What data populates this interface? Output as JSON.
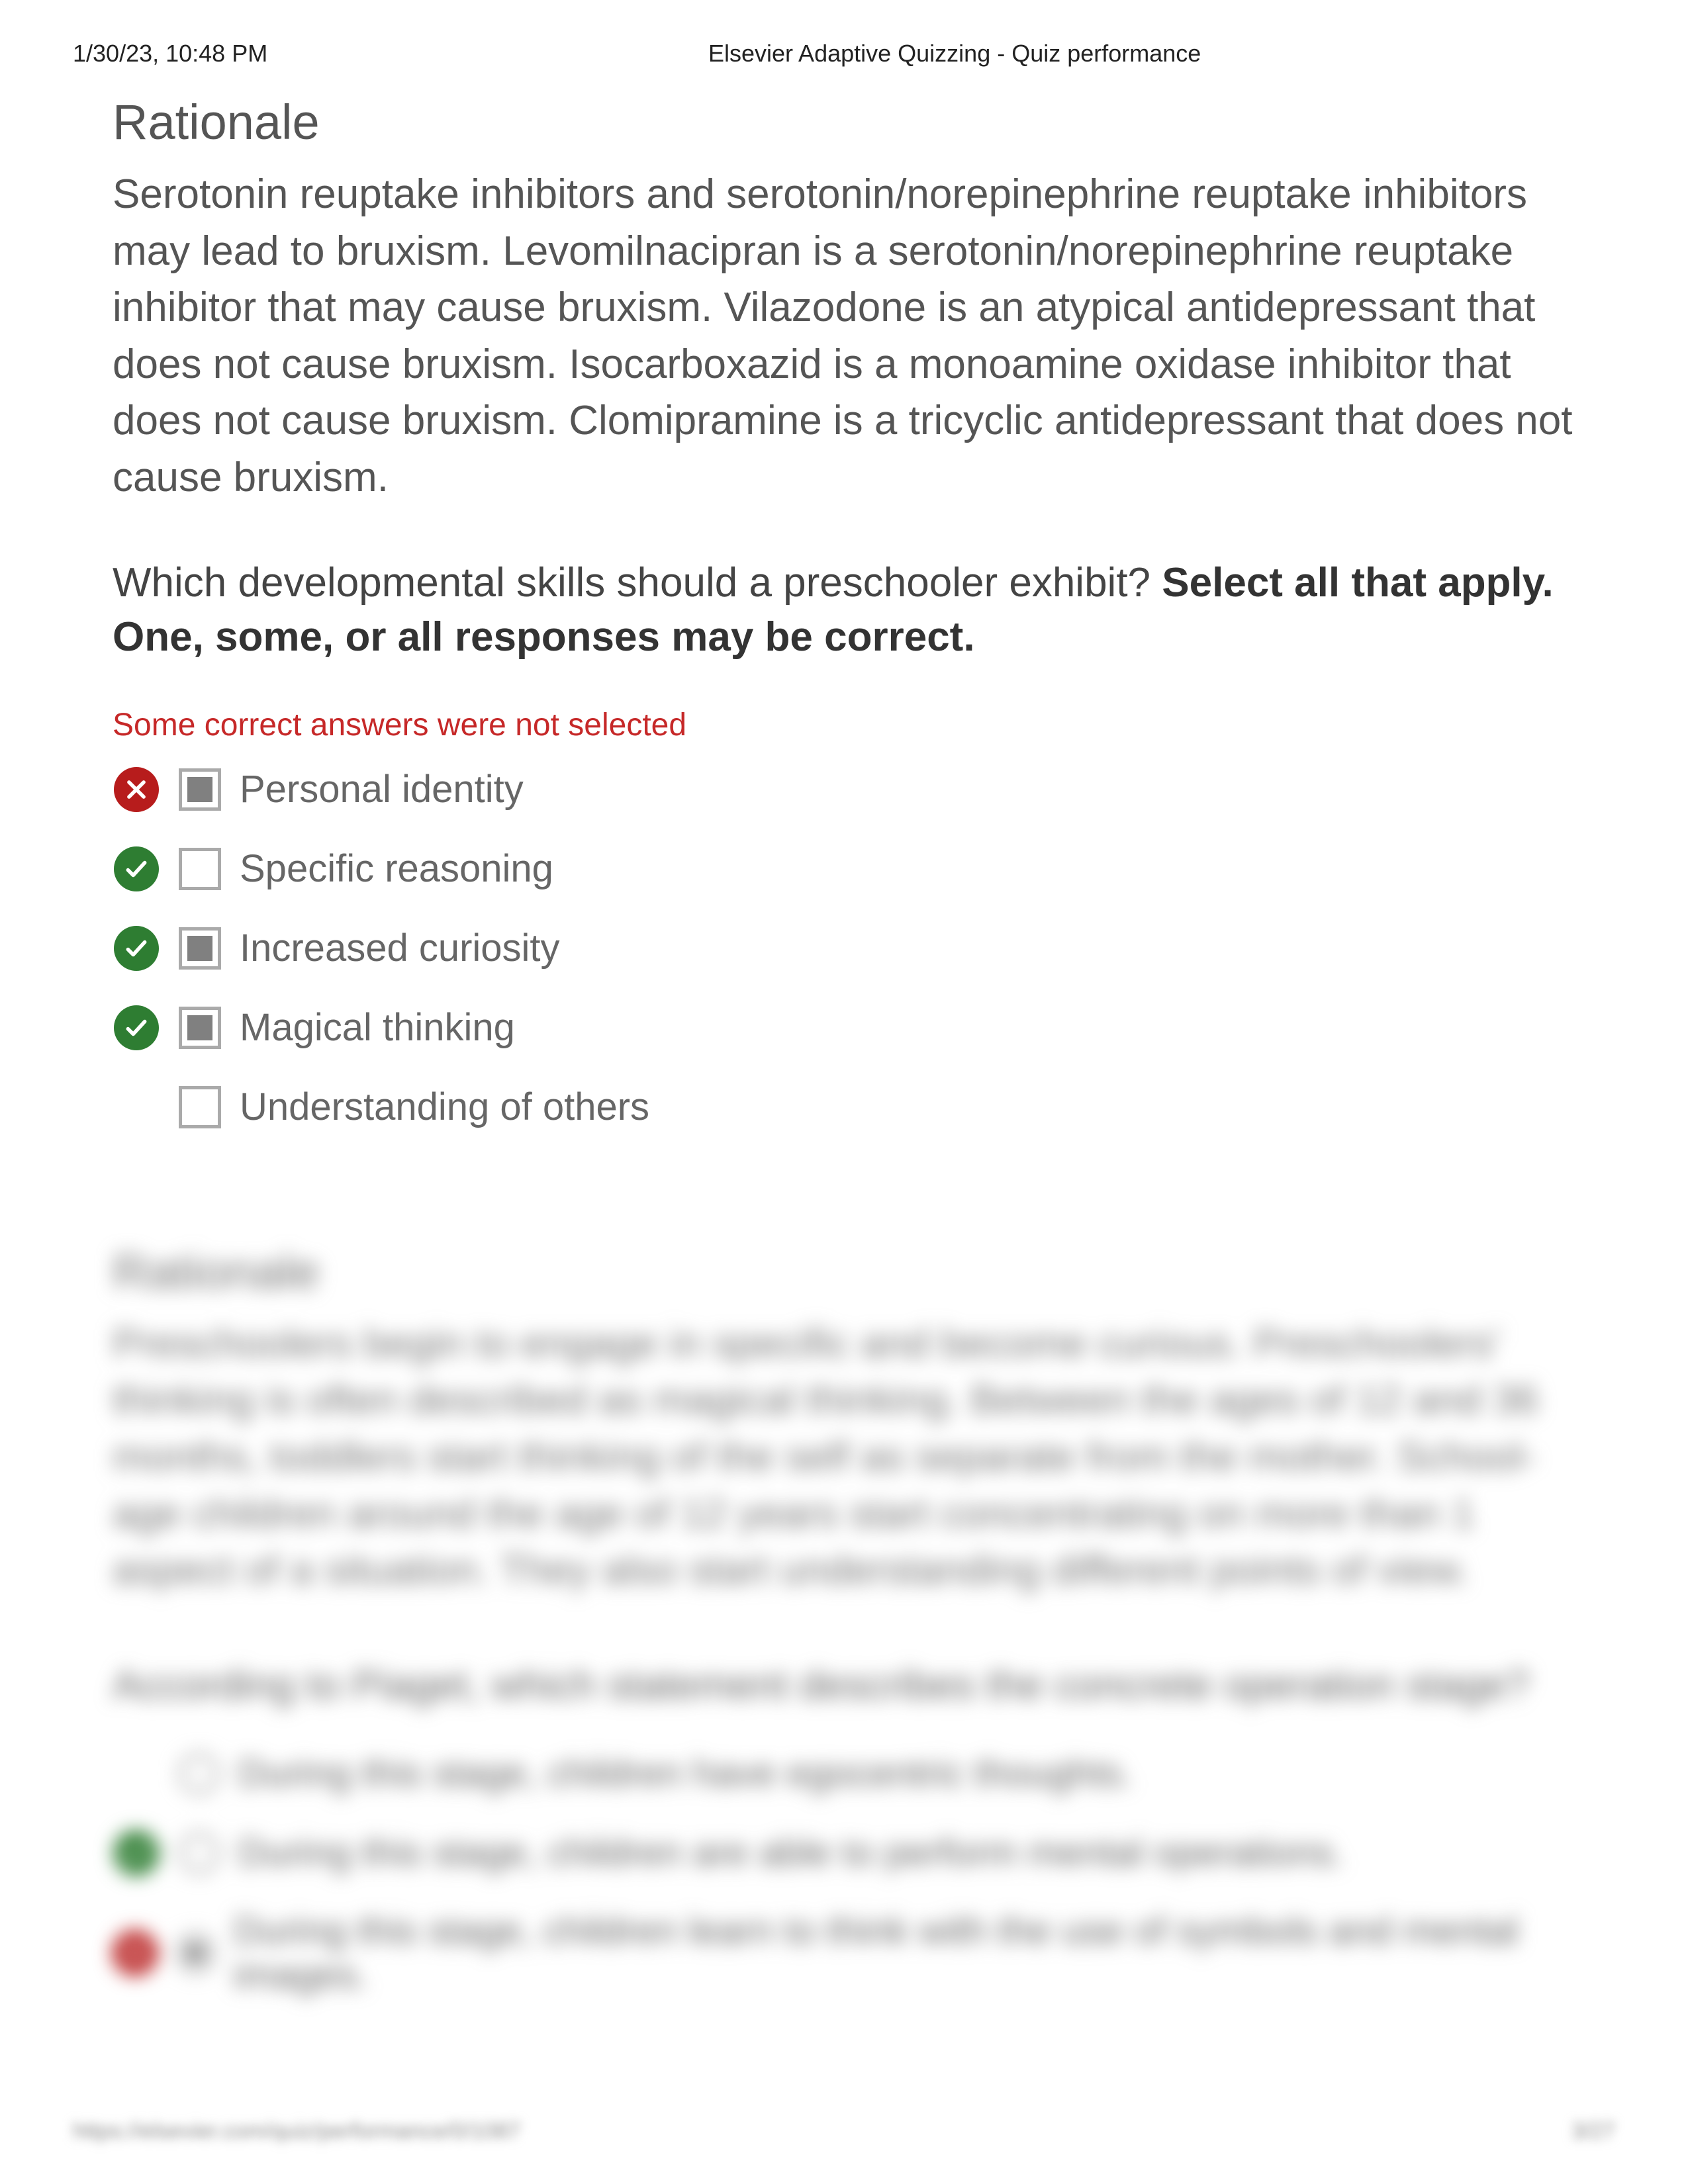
{
  "header": {
    "datetime": "1/30/23, 10:48 PM",
    "title": "Elsevier Adaptive Quizzing - Quiz performance"
  },
  "rationale1": {
    "heading": "Rationale",
    "body": "Serotonin reuptake inhibitors and serotonin/norepinephrine reuptake inhibitors may lead to bruxism. Levomilnacipran is a serotonin/norepinephrine reuptake inhibitor that may cause bruxism. Vilazodone is an atypical antidepressant that does not cause bruxism. Isocarboxazid is a monoamine oxidase inhibitor that does not cause bruxism. Clomipramine is a tricyclic antidepressant that does not cause bruxism."
  },
  "question1": {
    "stem_plain": "Which developmental skills should a preschooler exhibit? ",
    "stem_bold": "Select all that apply. One, some, or all responses may be correct.",
    "feedback": "Some correct answers were not selected",
    "answers": [
      {
        "label": "Personal identity",
        "status": "incorrect",
        "checked": true
      },
      {
        "label": "Specific reasoning",
        "status": "correct",
        "checked": false
      },
      {
        "label": "Increased curiosity",
        "status": "correct",
        "checked": true
      },
      {
        "label": "Magical thinking",
        "status": "correct",
        "checked": true
      },
      {
        "label": "Understanding of others",
        "status": "none",
        "checked": false
      }
    ]
  },
  "rationale2": {
    "heading": "Rationale",
    "body": "Preschoolers begin to engage in specific and become curious. Preschoolers' thinking is often described as magical thinking. Between the ages of 12 and 36 months, toddlers start thinking of the self as separate from the mother. School-age children around the age of 12 years start concentrating on more than 1 aspect of a situation. They also start understanding different points of view."
  },
  "question2": {
    "stem": "According to Piaget, which statement describes the concrete operation stage?",
    "answers": [
      {
        "label": "During this stage, children have egocentric thoughts.",
        "status": "none",
        "selected": false
      },
      {
        "label": "During this stage, children are able to perform mental operations.",
        "status": "correct",
        "selected": false
      },
      {
        "label": "During this stage, children learn to think with the use of symbols and mental images.",
        "status": "incorrect",
        "selected": true
      }
    ]
  },
  "footer": {
    "url": "https://elsevier.com/quiz/performance/0/1087",
    "page": "3/27"
  }
}
